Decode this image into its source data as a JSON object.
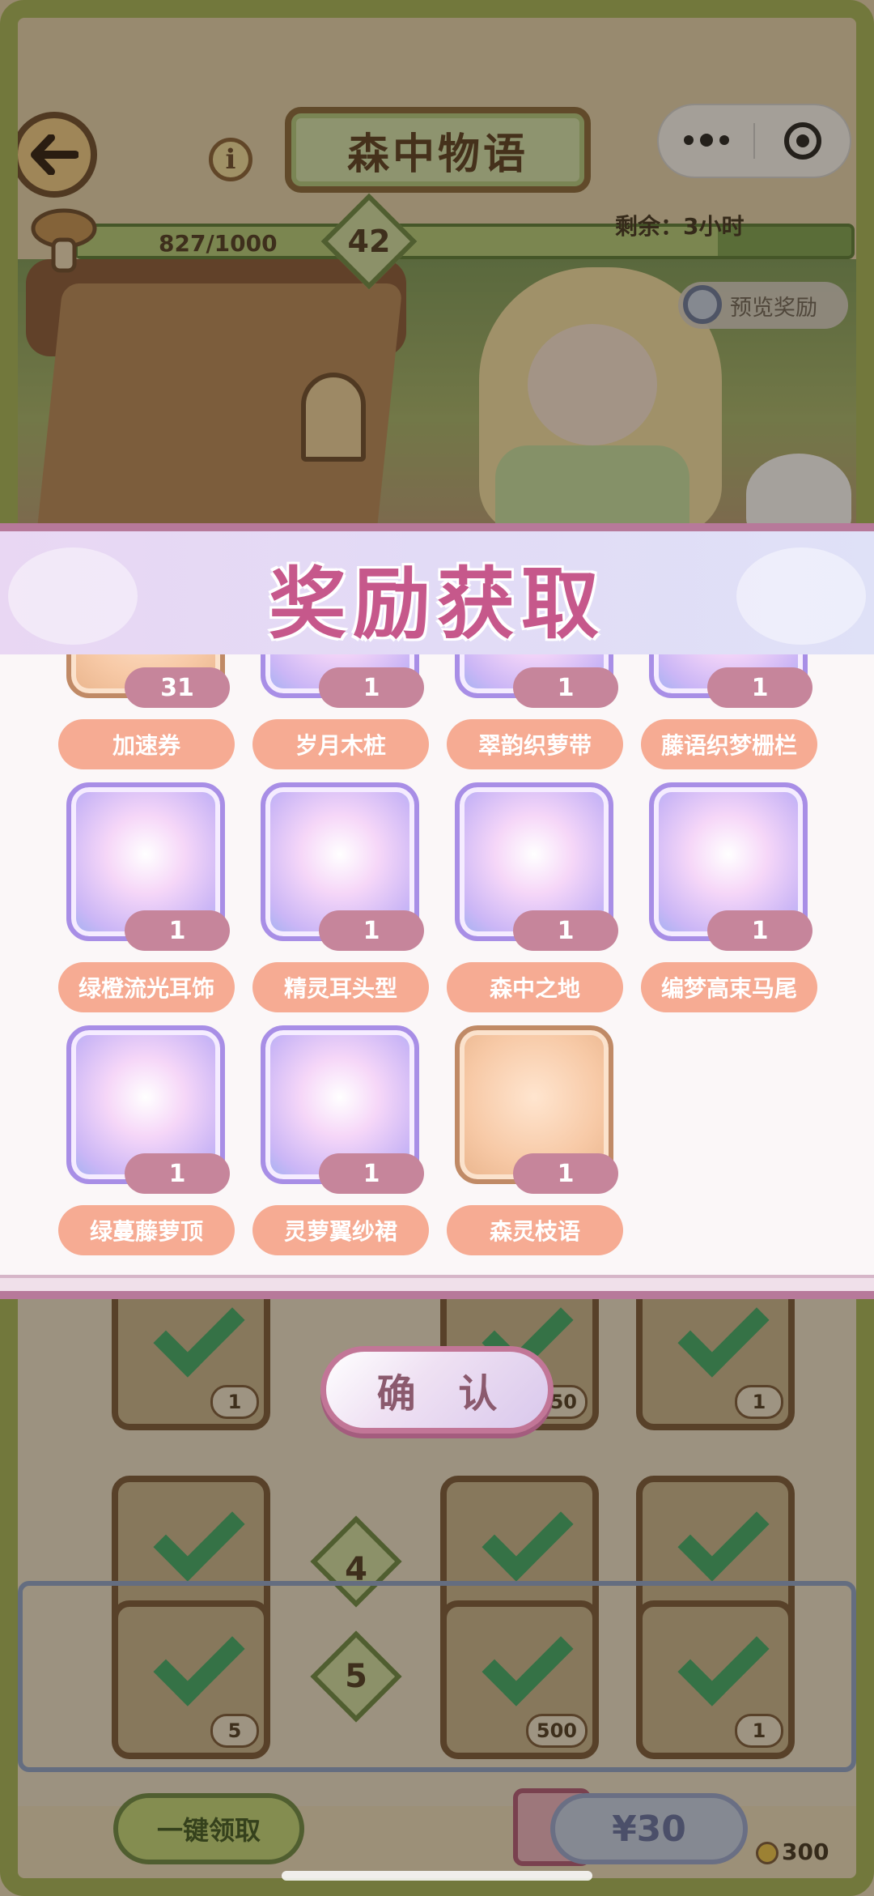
{
  "header": {
    "title": "森中物语",
    "progress_text": "827/1000",
    "progress_fraction": 0.827,
    "level": "42",
    "remaining": "剩余：3小时",
    "preview_label": "预览奖励"
  },
  "modal": {
    "title": "奖励获取",
    "confirm_label": "确 认",
    "rewards": [
      {
        "name": "加速券",
        "count": "31",
        "style": "tan"
      },
      {
        "name": "岁月木桩",
        "count": "1",
        "style": "purple"
      },
      {
        "name": "翠韵织萝带",
        "count": "1",
        "style": "purple"
      },
      {
        "name": "藤语织梦栅栏",
        "count": "1",
        "style": "purple"
      },
      {
        "name": "绿橙流光耳饰",
        "count": "1",
        "style": "purple"
      },
      {
        "name": "精灵耳头型",
        "count": "1",
        "style": "purple"
      },
      {
        "name": "森中之地",
        "count": "1",
        "style": "purple"
      },
      {
        "name": "编梦高束马尾",
        "count": "1",
        "style": "purple"
      },
      {
        "name": "绿蔓藤萝顶",
        "count": "1",
        "style": "purple"
      },
      {
        "name": "灵萝翼纱裙",
        "count": "1",
        "style": "purple"
      },
      {
        "name": "森灵枝语",
        "count": "1",
        "style": "tan"
      }
    ]
  },
  "background_grid": {
    "rows": [
      {
        "level": "",
        "slots": [
          {
            "count": "1"
          },
          {
            "count": "350"
          },
          {
            "count": "1"
          }
        ]
      },
      {
        "level": "4",
        "slots": [
          {
            "count": ""
          },
          {
            "count": ""
          },
          {
            "count": ""
          }
        ]
      },
      {
        "level": "5",
        "slots": [
          {
            "count": "5"
          },
          {
            "count": "500"
          },
          {
            "count": "1"
          }
        ]
      }
    ]
  },
  "footer": {
    "claim_all_label": "一键领取",
    "price_label": "¥30",
    "coin_value": "300"
  },
  "colors": {
    "accent_pink": "#c6588b",
    "count_badge": "#c6859b",
    "name_pill": "#f6ab93",
    "check_green": "#3fae6b"
  }
}
